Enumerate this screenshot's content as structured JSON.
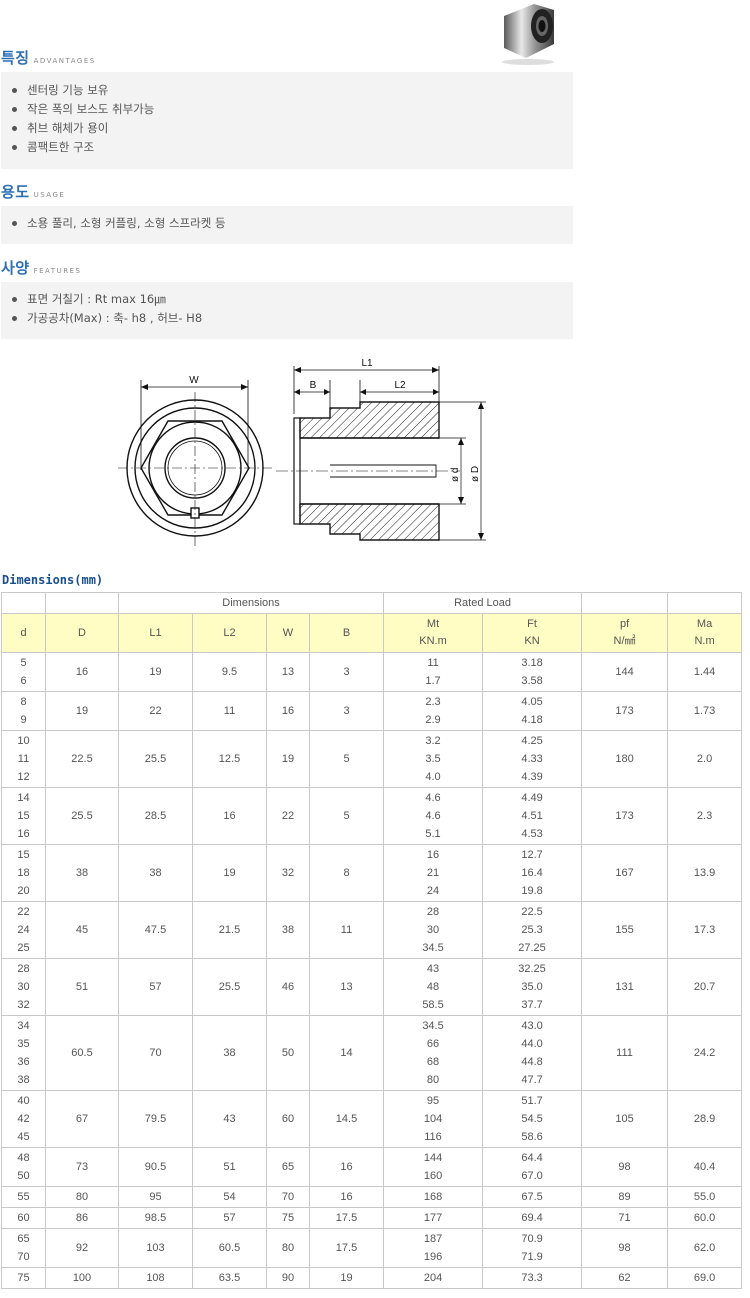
{
  "sections": {
    "advantages": {
      "title": "특징",
      "subtitle": "ADVANTAGES",
      "items": [
        "센터링 기능 보유",
        "작은 폭의 보스도 취부가능",
        "취브 해체가 용이",
        "콤팩트한 구조"
      ]
    },
    "usage": {
      "title": "용도",
      "subtitle": "USAGE",
      "items": [
        "소용 풀리, 소형 커플링, 소형 스프라켓 등"
      ]
    },
    "features": {
      "title": "사양",
      "subtitle": "FEATURES",
      "items": [
        "표면 거칠기 : Rt max 16㎛",
        "가공공차(Max) : 축- h8 , 허브- H8"
      ]
    }
  },
  "diagram": {
    "labels": {
      "w": "W",
      "l1": "L1",
      "b": "B",
      "l2": "L2",
      "d_small": "ø d",
      "d_large": "ø D"
    }
  },
  "table": {
    "title": "Dimensions(mm)",
    "group_headers": {
      "dimensions": "Dimensions",
      "rated_load": "Rated Load"
    },
    "col_headers": {
      "d": "d",
      "D": "D",
      "L1": "L1",
      "L2": "L2",
      "W": "W",
      "B": "B",
      "mt": "Mt",
      "mt_unit": "KN.m",
      "ft": "Ft",
      "ft_unit": "KN",
      "pf": "pf",
      "pf_unit": "N/㎟",
      "ma": "Ma",
      "ma_unit": "N.m"
    },
    "rows": [
      {
        "d": [
          "5",
          "6"
        ],
        "D": "16",
        "L1": "19",
        "L2": "9.5",
        "W": "13",
        "B": "3",
        "Mt": [
          "11",
          "1.7"
        ],
        "Ft": [
          "3.18",
          "3.58"
        ],
        "pf": "144",
        "Ma": "1.44"
      },
      {
        "d": [
          "8",
          "9"
        ],
        "D": "19",
        "L1": "22",
        "L2": "11",
        "W": "16",
        "B": "3",
        "Mt": [
          "2.3",
          "2.9"
        ],
        "Ft": [
          "4.05",
          "4.18"
        ],
        "pf": "173",
        "Ma": "1.73"
      },
      {
        "d": [
          "10",
          "11",
          "12"
        ],
        "D": "22.5",
        "L1": "25.5",
        "L2": "12.5",
        "W": "19",
        "B": "5",
        "Mt": [
          "3.2",
          "3.5",
          "4.0"
        ],
        "Ft": [
          "4.25",
          "4.33",
          "4.39"
        ],
        "pf": "180",
        "Ma": "2.0"
      },
      {
        "d": [
          "14",
          "15",
          "16"
        ],
        "D": "25.5",
        "L1": "28.5",
        "L2": "16",
        "W": "22",
        "B": "5",
        "Mt": [
          "4.6",
          "4.6",
          "5.1"
        ],
        "Ft": [
          "4.49",
          "4.51",
          "4.53"
        ],
        "pf": "173",
        "Ma": "2.3"
      },
      {
        "d": [
          "15",
          "18",
          "20"
        ],
        "D": "38",
        "L1": "38",
        "L2": "19",
        "W": "32",
        "B": "8",
        "Mt": [
          "16",
          "21",
          "24"
        ],
        "Ft": [
          "12.7",
          "16.4",
          "19.8"
        ],
        "pf": "167",
        "Ma": "13.9"
      },
      {
        "d": [
          "22",
          "24",
          "25"
        ],
        "D": "45",
        "L1": "47.5",
        "L2": "21.5",
        "W": "38",
        "B": "11",
        "Mt": [
          "28",
          "30",
          "34.5"
        ],
        "Ft": [
          "22.5",
          "25.3",
          "27.25"
        ],
        "pf": "155",
        "Ma": "17.3"
      },
      {
        "d": [
          "28",
          "30",
          "32"
        ],
        "D": "51",
        "L1": "57",
        "L2": "25.5",
        "W": "46",
        "B": "13",
        "Mt": [
          "43",
          "48",
          "58.5"
        ],
        "Ft": [
          "32.25",
          "35.0",
          "37.7"
        ],
        "pf": "131",
        "Ma": "20.7"
      },
      {
        "d": [
          "34",
          "35",
          "36",
          "38"
        ],
        "D": "60.5",
        "L1": "70",
        "L2": "38",
        "W": "50",
        "B": "14",
        "Mt": [
          "34.5",
          "66",
          "68",
          "80"
        ],
        "Ft": [
          "43.0",
          "44.0",
          "44.8",
          "47.7"
        ],
        "pf": "111",
        "Ma": "24.2"
      },
      {
        "d": [
          "40",
          "42",
          "45"
        ],
        "D": "67",
        "L1": "79.5",
        "L2": "43",
        "W": "60",
        "B": "14.5",
        "Mt": [
          "95",
          "104",
          "116"
        ],
        "Ft": [
          "51.7",
          "54.5",
          "58.6"
        ],
        "pf": "105",
        "Ma": "28.9"
      },
      {
        "d": [
          "48",
          "50"
        ],
        "D": "73",
        "L1": "90.5",
        "L2": "51",
        "W": "65",
        "B": "16",
        "Mt": [
          "144",
          "160"
        ],
        "Ft": [
          "64.4",
          "67.0"
        ],
        "pf": "98",
        "Ma": "40.4"
      },
      {
        "d": [
          "55"
        ],
        "D": "80",
        "L1": "95",
        "L2": "54",
        "W": "70",
        "B": "16",
        "Mt": [
          "168"
        ],
        "Ft": [
          "67.5"
        ],
        "pf": "89",
        "Ma": "55.0"
      },
      {
        "d": [
          "60"
        ],
        "D": "86",
        "L1": "98.5",
        "L2": "57",
        "W": "75",
        "B": "17.5",
        "Mt": [
          "177"
        ],
        "Ft": [
          "69.4"
        ],
        "pf": "71",
        "Ma": "60.0"
      },
      {
        "d": [
          "65",
          "70"
        ],
        "D": "92",
        "L1": "103",
        "L2": "60.5",
        "W": "80",
        "B": "17.5",
        "Mt": [
          "187",
          "196"
        ],
        "Ft": [
          "70.9",
          "71.9"
        ],
        "pf": "98",
        "Ma": "62.0"
      },
      {
        "d": [
          "75"
        ],
        "D": "100",
        "L1": "108",
        "L2": "63.5",
        "W": "90",
        "B": "19",
        "Mt": [
          "204"
        ],
        "Ft": [
          "73.3"
        ],
        "pf": "62",
        "Ma": "69.0"
      }
    ]
  }
}
